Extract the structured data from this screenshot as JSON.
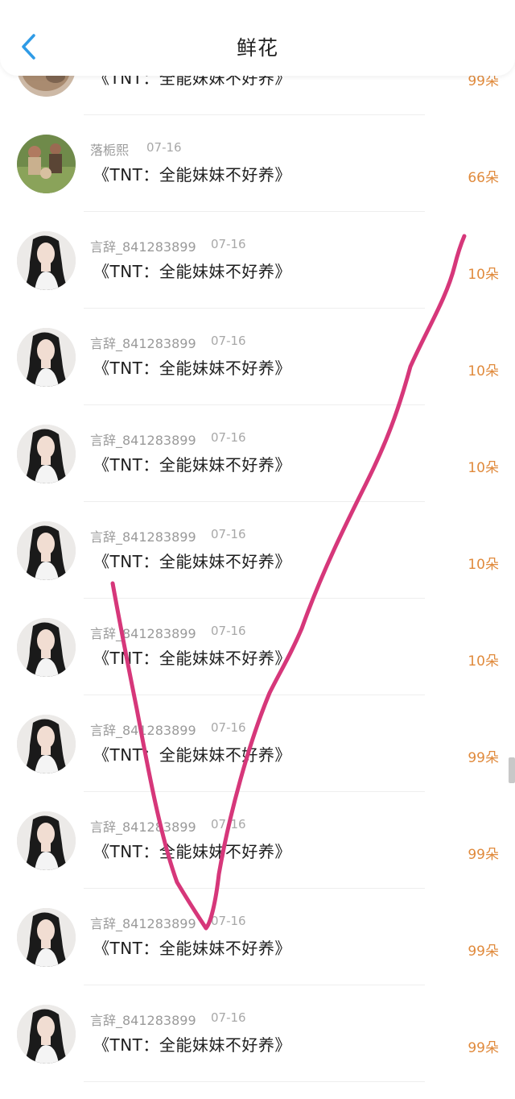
{
  "header": {
    "title": "鲜花",
    "back_icon": "chevron-left-icon"
  },
  "colors": {
    "accent_orange": "#e08a3c",
    "back_blue": "#2f9be6",
    "annotation_pink": "#d6377a"
  },
  "list": [
    {
      "username": "",
      "date": "",
      "title": "《TNT：全能妹妹不好养》",
      "flowers": "99朵",
      "avatar": "cat-photo"
    },
    {
      "username": "落栀熙",
      "date": "07-16",
      "title": "《TNT：全能妹妹不好养》",
      "flowers": "66朵",
      "avatar": "group-photo"
    },
    {
      "username": "言辞_841283899",
      "date": "07-16",
      "title": "《TNT：全能妹妹不好养》",
      "flowers": "10朵",
      "avatar": "girl-photo"
    },
    {
      "username": "言辞_841283899",
      "date": "07-16",
      "title": "《TNT：全能妹妹不好养》",
      "flowers": "10朵",
      "avatar": "girl-photo"
    },
    {
      "username": "言辞_841283899",
      "date": "07-16",
      "title": "《TNT：全能妹妹不好养》",
      "flowers": "10朵",
      "avatar": "girl-photo"
    },
    {
      "username": "言辞_841283899",
      "date": "07-16",
      "title": "《TNT：全能妹妹不好养》",
      "flowers": "10朵",
      "avatar": "girl-photo"
    },
    {
      "username": "言辞_841283899",
      "date": "07-16",
      "title": "《TNT：全能妹妹不好养》",
      "flowers": "10朵",
      "avatar": "girl-photo"
    },
    {
      "username": "言辞_841283899",
      "date": "07-16",
      "title": "《TNT：全能妹妹不好养》",
      "flowers": "99朵",
      "avatar": "girl-photo"
    },
    {
      "username": "言辞_841283899",
      "date": "07-16",
      "title": "《TNT：全能妹妹不好养》",
      "flowers": "99朵",
      "avatar": "girl-photo"
    },
    {
      "username": "言辞_841283899",
      "date": "07-16",
      "title": "《TNT：全能妹妹不好养》",
      "flowers": "99朵",
      "avatar": "girl-photo"
    },
    {
      "username": "言辞_841283899",
      "date": "07-16",
      "title": "《TNT：全能妹妹不好养》",
      "flowers": "99朵",
      "avatar": "girl-photo"
    }
  ]
}
